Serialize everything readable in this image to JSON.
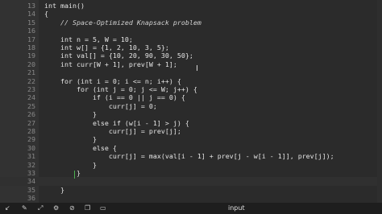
{
  "editor": {
    "lines": [
      {
        "num": "13",
        "code": "int main()"
      },
      {
        "num": "14",
        "code": "{"
      },
      {
        "num": "15",
        "code": "    // Space-Optimized Knapsack problem"
      },
      {
        "num": "16",
        "code": ""
      },
      {
        "num": "17",
        "code": "    int n = 5, W = 10;"
      },
      {
        "num": "18",
        "code": "    int w[] = {1, 2, 10, 3, 5};"
      },
      {
        "num": "19",
        "code": "    int val[] = {10, 20, 90, 30, 50};"
      },
      {
        "num": "20",
        "code": "    int curr[W + 1], prev[W + 1];"
      },
      {
        "num": "21",
        "code": ""
      },
      {
        "num": "22",
        "code": "    for (int i = 0; i <= n; i++) {"
      },
      {
        "num": "23",
        "code": "        for (int j = 0; j <= W; j++) {"
      },
      {
        "num": "24",
        "code": "            if (i == 0 || j == 0) {"
      },
      {
        "num": "25",
        "code": "                curr[j] = 0;"
      },
      {
        "num": "26",
        "code": "            }"
      },
      {
        "num": "27",
        "code": "            else if (w[i - 1] > j) {"
      },
      {
        "num": "28",
        "code": "                curr[j] = prev[j];"
      },
      {
        "num": "29",
        "code": "            }"
      },
      {
        "num": "30",
        "code": "            else {"
      },
      {
        "num": "31",
        "code": "                curr[j] = max(val[i - 1] + prev[j - w[i - 1]], prev[j]);"
      },
      {
        "num": "32",
        "code": "            }"
      },
      {
        "num": "33",
        "code": "        }"
      },
      {
        "num": "34",
        "code": ""
      },
      {
        "num": "35",
        "code": "    }"
      },
      {
        "num": "36",
        "code": ""
      },
      {
        "num": "37",
        "code": "    cout << KS[n][W];"
      }
    ]
  },
  "statusbar": {
    "label": "input",
    "icons": [
      "arrow-icon",
      "pin-icon",
      "expand-icon",
      "settings-icon",
      "clear-icon",
      "copy-icon",
      "terminal-icon"
    ]
  },
  "colors": {
    "editor_bg": "#2b2b2b",
    "gutter_bg": "#323232",
    "cursor": "#4caf50"
  }
}
